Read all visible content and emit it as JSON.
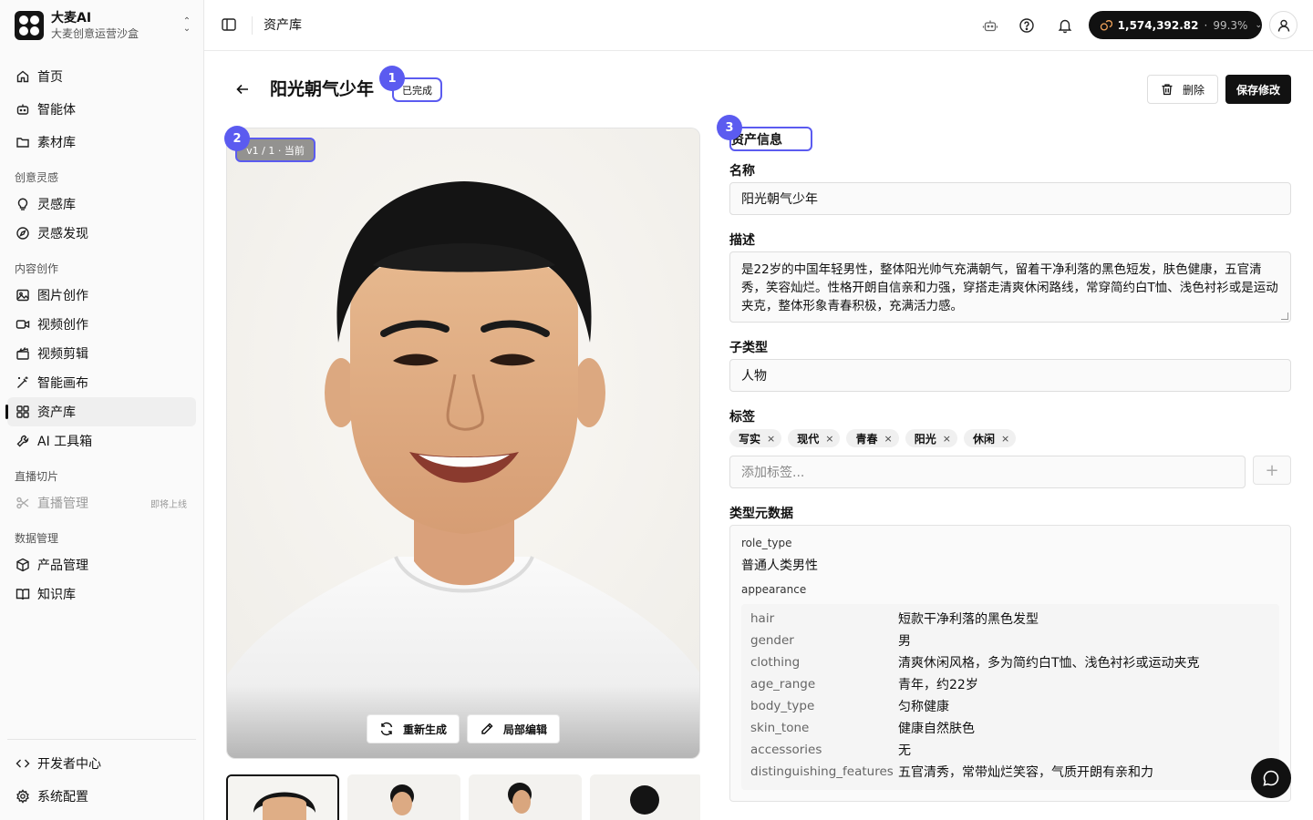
{
  "brand": {
    "name": "大麦AI",
    "subtitle": "大麦创意运营沙盒"
  },
  "sidebar": {
    "top_items": [
      {
        "label": "首页",
        "icon": "home-icon"
      },
      {
        "label": "智能体",
        "icon": "bot-icon"
      },
      {
        "label": "素材库",
        "icon": "folder-icon"
      }
    ],
    "groups": [
      {
        "title": "创意灵感",
        "items": [
          {
            "label": "灵感库",
            "icon": "lightbulb-icon"
          },
          {
            "label": "灵感发现",
            "icon": "compass-icon"
          }
        ]
      },
      {
        "title": "内容创作",
        "items": [
          {
            "label": "图片创作",
            "icon": "image-icon"
          },
          {
            "label": "视频创作",
            "icon": "video-icon"
          },
          {
            "label": "视频剪辑",
            "icon": "clapperboard-icon"
          },
          {
            "label": "智能画布",
            "icon": "magic-wand-icon"
          },
          {
            "label": "资产库",
            "icon": "grid-icon",
            "active": true
          },
          {
            "label": "AI 工具箱",
            "icon": "wrench-icon"
          }
        ]
      },
      {
        "title": "直播切片",
        "items": [
          {
            "label": "直播管理",
            "icon": "scissors-icon",
            "badge": "即将上线",
            "disabled": true
          }
        ]
      },
      {
        "title": "数据管理",
        "items": [
          {
            "label": "产品管理",
            "icon": "box-icon"
          },
          {
            "label": "知识库",
            "icon": "book-icon"
          }
        ]
      }
    ],
    "bottom_items": [
      {
        "label": "开发者中心",
        "icon": "code-icon"
      },
      {
        "label": "系统配置",
        "icon": "settings-icon"
      }
    ]
  },
  "topbar": {
    "breadcrumb": "资产库",
    "credits": {
      "amount": "1,574,392.82",
      "separator": "·",
      "percent": "99.3%"
    }
  },
  "page": {
    "title": "阳光朝气少年",
    "status": "已完成",
    "version_tag": "v1 / 1 · 当前",
    "delete_label": "删除",
    "save_label": "保存修改",
    "regenerate_label": "重新生成",
    "local_edit_label": "局部编辑",
    "markers": [
      "1",
      "2",
      "3"
    ]
  },
  "form": {
    "section_title": "资产信息",
    "name_label": "名称",
    "name_value": "阳光朝气少年",
    "desc_label": "描述",
    "desc_value": "是22岁的中国年轻男性，整体阳光帅气充满朝气，留着干净利落的黑色短发，肤色健康，五官清秀，笑容灿烂。性格开朗自信亲和力强，穿搭走清爽休闲路线，常穿简约白T恤、浅色衬衫或是运动夹克，整体形象青春积极，充满活力感。",
    "subtype_label": "子类型",
    "subtype_value": "人物",
    "tags_label": "标签",
    "tags": [
      "写实",
      "现代",
      "青春",
      "阳光",
      "休闲"
    ],
    "tag_placeholder": "添加标签...",
    "tag_add": "+",
    "meta_label": "类型元数据",
    "meta": {
      "role_type_key": "role_type",
      "role_type_value": "普通人类男性",
      "appearance_key": "appearance",
      "appearance": [
        {
          "k": "hair",
          "v": "短款干净利落的黑色发型"
        },
        {
          "k": "gender",
          "v": "男"
        },
        {
          "k": "clothing",
          "v": "清爽休闲风格，多为简约白T恤、浅色衬衫或运动夹克"
        },
        {
          "k": "age_range",
          "v": "青年，约22岁"
        },
        {
          "k": "body_type",
          "v": "匀称健康"
        },
        {
          "k": "skin_tone",
          "v": "健康自然肤色"
        },
        {
          "k": "accessories",
          "v": "无"
        },
        {
          "k": "distinguishing_features",
          "v": "五官清秀，常带灿烂笑容，气质开朗有亲和力"
        }
      ]
    }
  },
  "colors": {
    "accent": "#5b5bf0",
    "primary": "#111111"
  }
}
